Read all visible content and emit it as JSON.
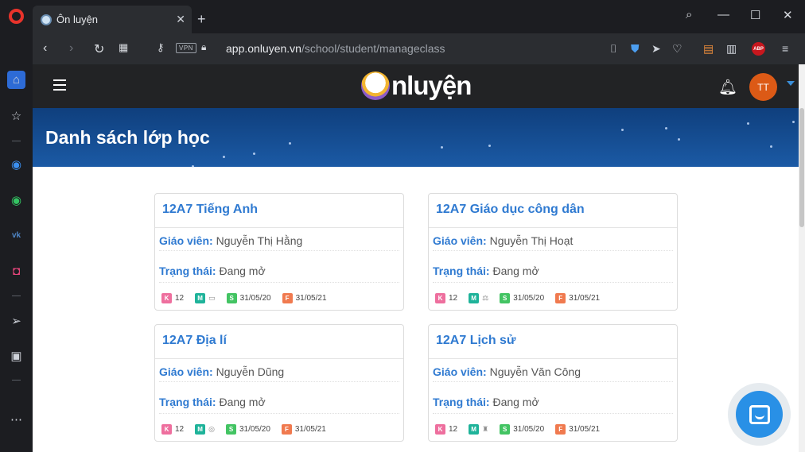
{
  "browser": {
    "tab_title": "Ôn luyện",
    "url_host": "app.onluyen.vn",
    "url_path": "/school/student/manageclass",
    "vpn_label": "VPN",
    "abp_label": "ABP"
  },
  "site": {
    "brand": "nluyện",
    "avatar_initials": "TT",
    "page_title": "Danh sách lớp học"
  },
  "labels": {
    "teacher": "Giáo viên:",
    "status": "Trạng thái:"
  },
  "classes": [
    {
      "name": "12A7 Tiếng Anh",
      "teacher": "Nguyễn Thị Hằng",
      "status": "Đang mở",
      "k": "12",
      "start": "31/05/20",
      "end": "31/05/21"
    },
    {
      "name": "12A7 Giáo dục công dân",
      "teacher": "Nguyễn Thị Hoạt",
      "status": "Đang mở",
      "k": "12",
      "start": "31/05/20",
      "end": "31/05/21"
    },
    {
      "name": "12A7 Địa lí",
      "teacher": "Nguyễn Dũng",
      "status": "Đang mở",
      "k": "12",
      "start": "31/05/20",
      "end": "31/05/21"
    },
    {
      "name": "12A7 Lịch sử",
      "teacher": "Nguyễn Văn Công",
      "status": "Đang mở",
      "k": "12",
      "start": "31/05/20",
      "end": "31/05/21"
    }
  ],
  "badges": {
    "k": "K",
    "m": "M",
    "s": "S",
    "f": "F"
  },
  "colors": {
    "accent": "#2f7ad1",
    "header": "#222325",
    "banner": "#1b5aa5",
    "avatar": "#dc5a16",
    "chat": "#2990e6"
  }
}
